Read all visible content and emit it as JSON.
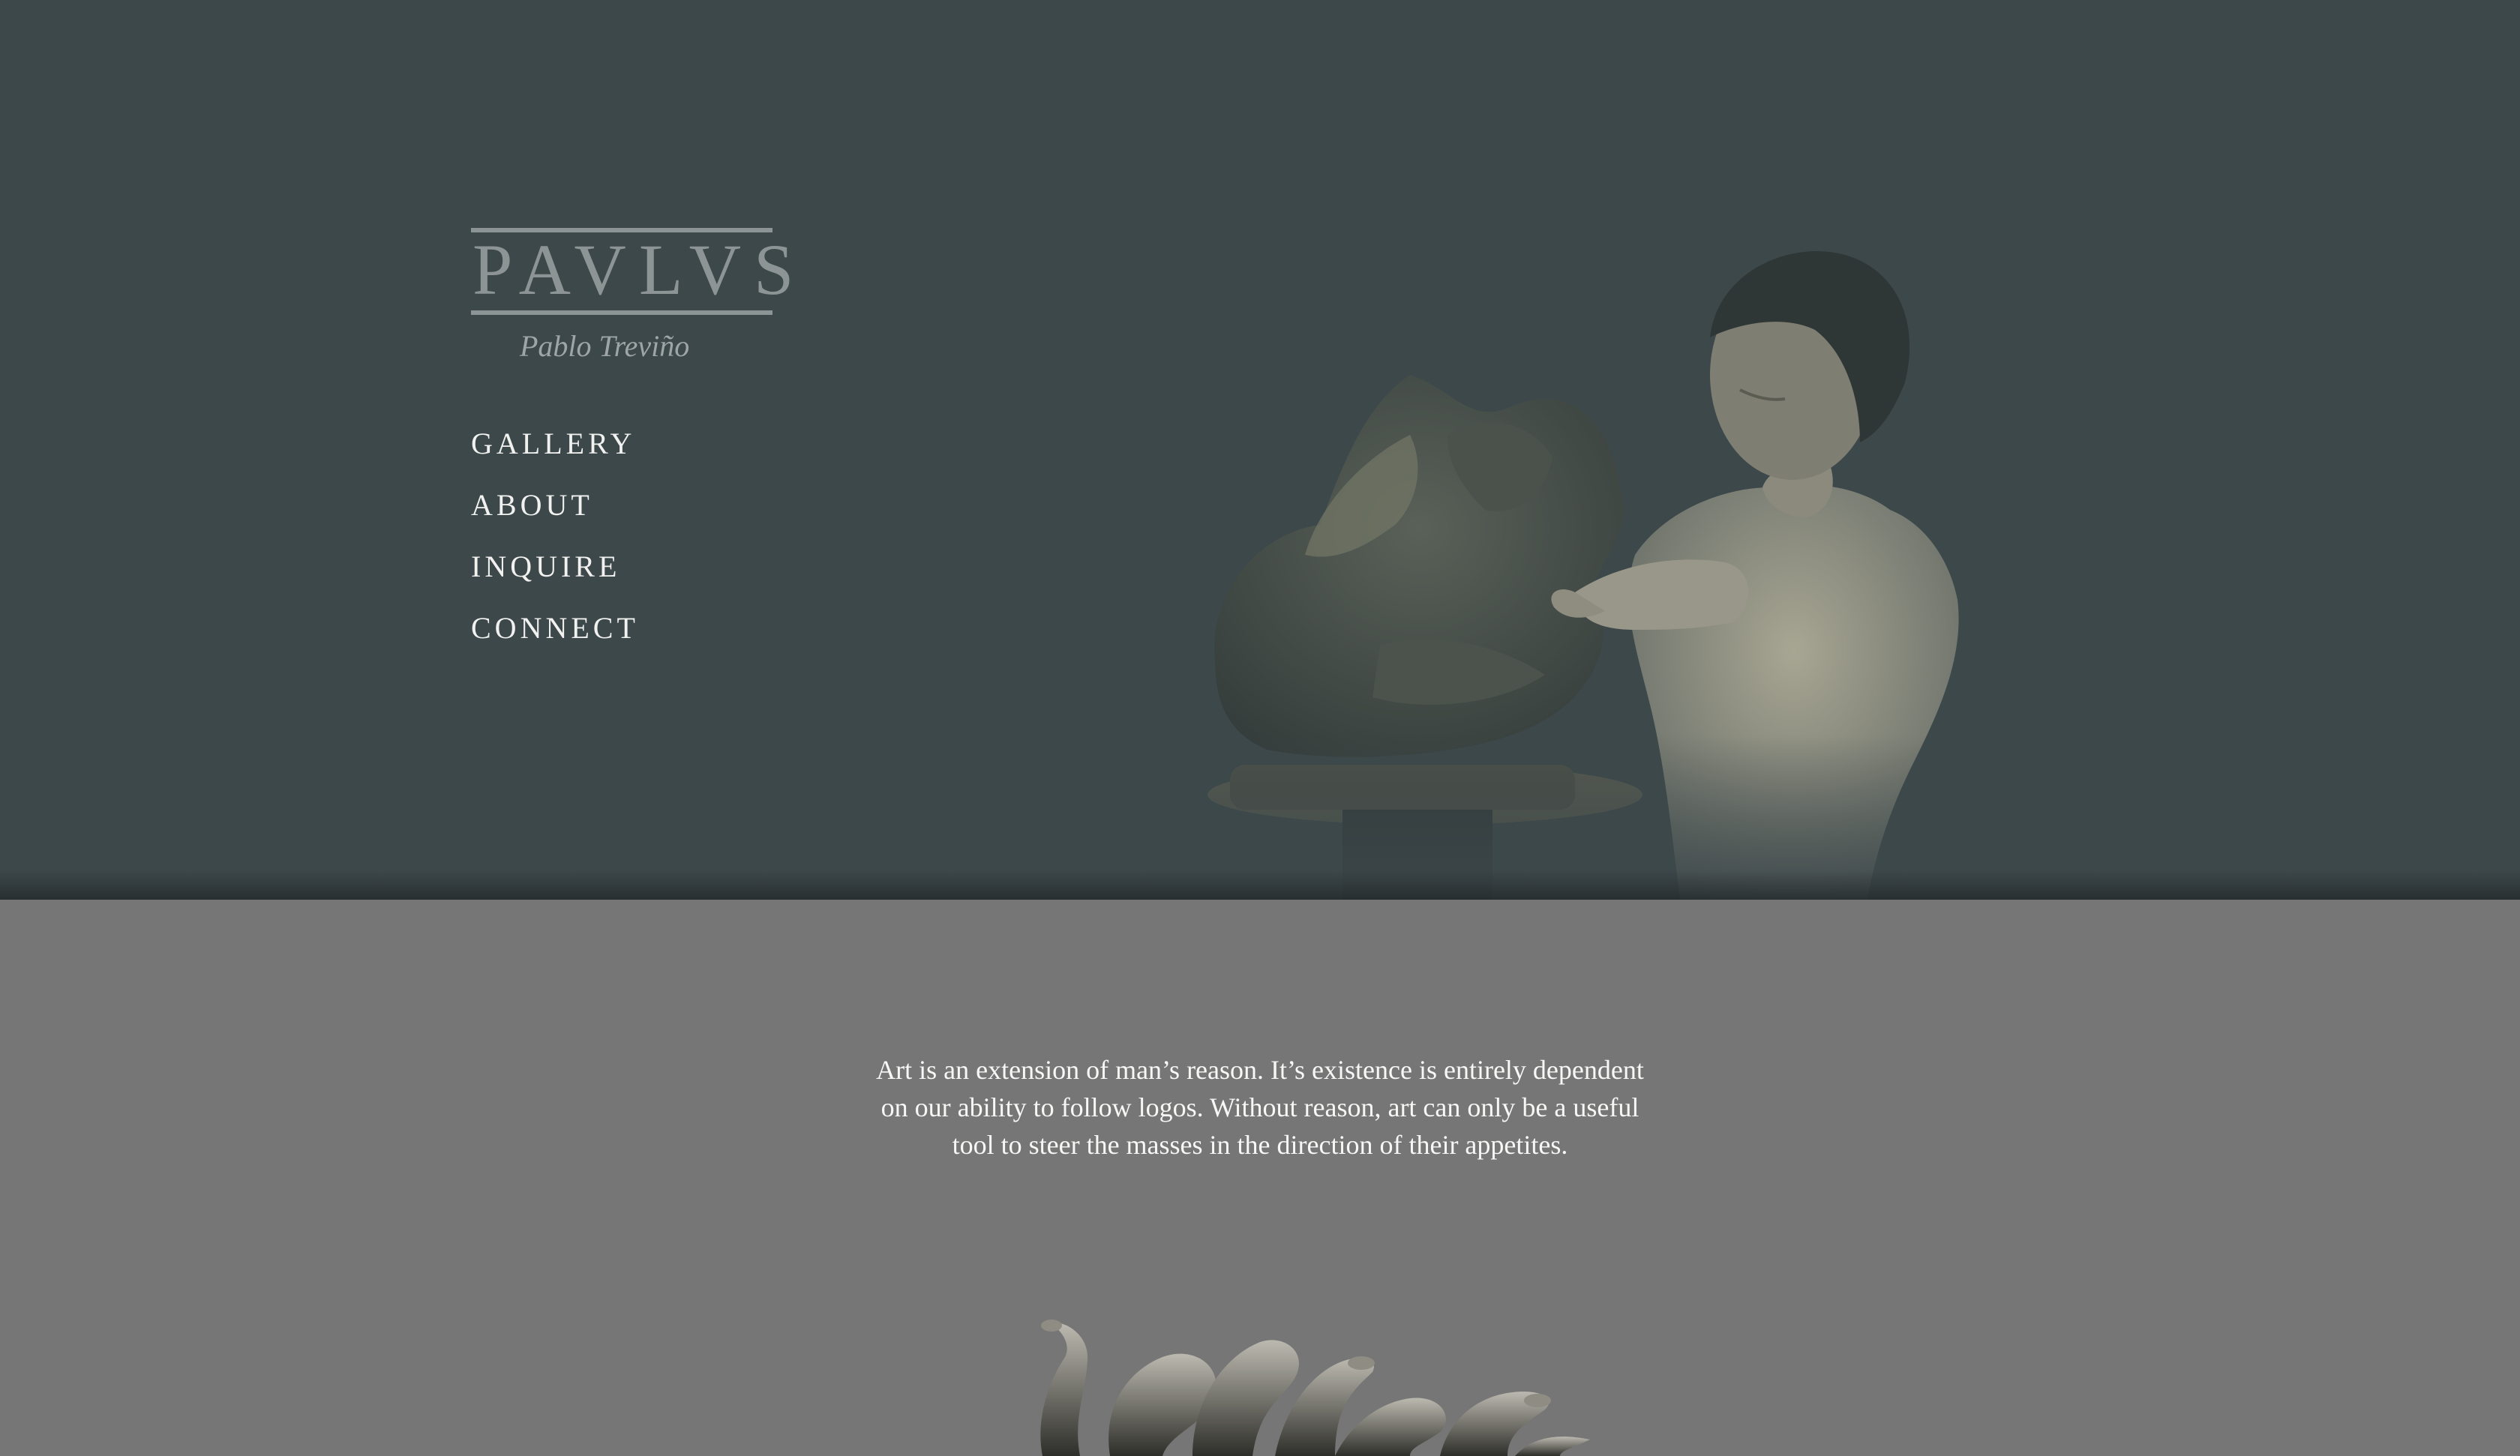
{
  "brand": {
    "wordmark": "PAVLVS",
    "artist_name": "Pablo Treviño"
  },
  "nav": {
    "items": [
      {
        "label": "GALLERY"
      },
      {
        "label": "ABOUT"
      },
      {
        "label": "INQUIRE"
      },
      {
        "label": "CONNECT"
      }
    ]
  },
  "hero": {
    "image": "artist-sculpting-photo",
    "background_color": "#3d484b"
  },
  "quote": {
    "text": "Art is an extension of man’s reason. It’s existence is entirely dependent on our ability to follow logos. Without reason, art can only be a useful tool to steer the masses in the direction of their appetites."
  },
  "featured_sculpture": {
    "image": "serpent-sculpture"
  },
  "colors": {
    "hero_bg": "#3d484b",
    "section_bg": "#767676",
    "logo": "#8c9495",
    "nav_text": "#f1f1ef"
  }
}
